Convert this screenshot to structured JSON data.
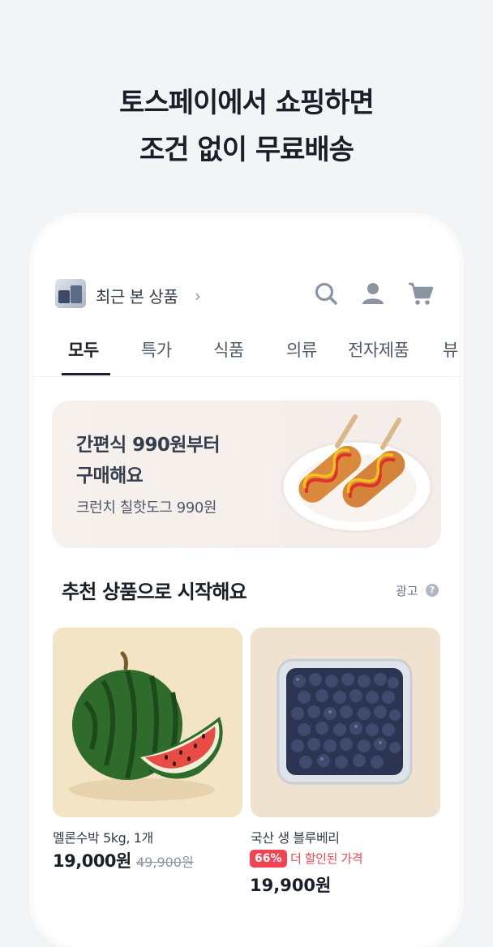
{
  "headline": {
    "line1": "토스페이에서 쇼핑하면",
    "line2": "조건 없이 무료배송"
  },
  "topbar": {
    "recent_label": "최근 본 상품",
    "icons": [
      "search-icon",
      "user-icon",
      "cart-icon"
    ]
  },
  "tabs": [
    {
      "label": "모두",
      "active": true
    },
    {
      "label": "특가"
    },
    {
      "label": "식품"
    },
    {
      "label": "의류"
    },
    {
      "label": "전자제품"
    },
    {
      "label": "뷰"
    }
  ],
  "banner": {
    "title_line1": "간편식 990원부터",
    "title_line2": "구매해요",
    "subtitle": "크런치 칠핫도그 990원"
  },
  "section": {
    "title": "추천 상품으로 시작해요",
    "ad_label": "광고",
    "ad_info": "?"
  },
  "products": [
    {
      "name": "멜론수박 5kg, 1개",
      "price": "19,000원",
      "original_price": "49,900원"
    },
    {
      "name": "국산 생 블루베리",
      "discount_badge": "66%",
      "deal_text": "더 할인된 가격",
      "price": "19,900원"
    }
  ],
  "colors": {
    "background": "#f3f4f6",
    "accent_red": "#f04452",
    "text_primary": "#191f28"
  }
}
